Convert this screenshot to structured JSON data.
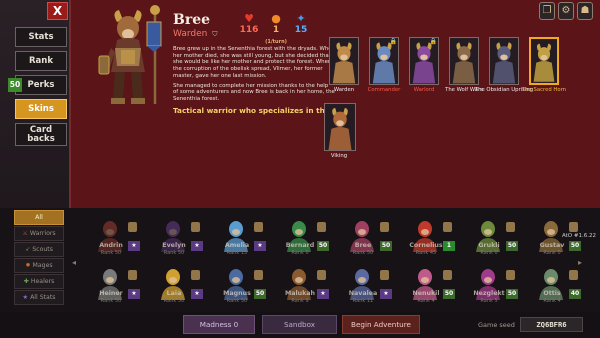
{
  "window": {
    "close_label": "X"
  },
  "menu": {
    "items": [
      {
        "label": "Stats"
      },
      {
        "label": "Rank"
      },
      {
        "label": "Perks",
        "badge": "50"
      },
      {
        "label": "Skins",
        "active": true
      },
      {
        "label": "Card\nbacks"
      }
    ]
  },
  "hero": {
    "name": "Bree",
    "class": "Warden",
    "stats": {
      "health": "116",
      "speed": "1",
      "speed_unit": "(1/turn)",
      "energy": "15"
    },
    "description": [
      "Bree grew up in the Senenthia forest with the dryads. When her mother died, she was still young, but she decided that she would be like her mother and protect the forest. When the corruption of the obelisk spread, Vlimer, her former master, gave her one last mission.",
      "She managed to complete her mission thanks to the help of some adventurers and now Bree is back in her home, the Senenthia forest."
    ],
    "tagline": "Tactical warrior who specializes in thorns."
  },
  "skins": [
    {
      "label": "Warden",
      "color": "#eeeeee",
      "locked": false
    },
    {
      "label": "Commander",
      "color": "#ff5a48",
      "locked": true
    },
    {
      "label": "Warlord",
      "color": "#ff5a48",
      "locked": true
    },
    {
      "label": "The Wolf Wars",
      "color": "#eeeeee",
      "locked": false
    },
    {
      "label": "The Obsidian Uprising",
      "color": "#eeeeee",
      "locked": false
    },
    {
      "label": "The Sacred Horn",
      "color": "#f5b83a",
      "locked": false,
      "selected": true
    },
    {
      "label": "Viking",
      "color": "#eeeeee",
      "locked": false
    }
  ],
  "filters": [
    {
      "label": "All",
      "active": true
    },
    {
      "label": "Warriors",
      "icon": "sword-icon"
    },
    {
      "label": "Scouts",
      "icon": "bow-icon"
    },
    {
      "label": "Mages",
      "icon": "fire-icon"
    },
    {
      "label": "Healers",
      "icon": "cross-icon"
    },
    {
      "label": "All Stats",
      "icon": "star-icon"
    }
  ],
  "roster": {
    "row1": [
      {
        "name": "Andrin",
        "rank": "Rank 50",
        "badge": "",
        "color": "#c24b3a"
      },
      {
        "name": "Evelyn",
        "rank": "Rank 50",
        "badge": "",
        "color": "#7e4aa8"
      },
      {
        "name": "Amelia",
        "rank": "Rank 15",
        "badge": "",
        "color": "#5a9bd0"
      },
      {
        "name": "Bernard",
        "rank": "Rank 0",
        "badge": "50",
        "color": "#3a8a4a"
      },
      {
        "name": "Bree",
        "rank": "Rank 50",
        "badge": "50",
        "color": "#a04060"
      },
      {
        "name": "Cornelius",
        "rank": "Rank 45",
        "badge": "1",
        "color": "#c0392b"
      },
      {
        "name": "Grukli",
        "rank": "Rank 0",
        "badge": "50",
        "color": "#6b8a3a"
      },
      {
        "name": "Gustav",
        "rank": "Rank 0",
        "badge": "50",
        "color": "#8a6a3a"
      }
    ],
    "row2": [
      {
        "name": "Heiner",
        "rank": "Rank 50",
        "badge": "",
        "color": "#7a7a7a"
      },
      {
        "name": "Laia",
        "rank": "Rank 50",
        "badge": "",
        "color": "#d0a030"
      },
      {
        "name": "Magnus",
        "rank": "Rank 50",
        "badge": "50",
        "color": "#4a6aa0"
      },
      {
        "name": "Malukah",
        "rank": "Rank 9",
        "badge": "",
        "color": "#8a5a30"
      },
      {
        "name": "Navalea",
        "rank": "Rank 11",
        "badge": "",
        "color": "#5a6aa0"
      },
      {
        "name": "Nenukil",
        "rank": "Rank 4",
        "badge": "50",
        "color": "#c05a8a"
      },
      {
        "name": "Nezglekt",
        "rank": "Rank 5",
        "badge": "50",
        "color": "#a03a8a"
      },
      {
        "name": "Ottis",
        "rank": "Rank 4",
        "badge": "40",
        "color": "#6a8a6a"
      }
    ]
  },
  "bottom": {
    "madness": "Madness 0",
    "sandbox": "Sandbox",
    "adventure": "Begin Adventure",
    "seed_label": "Game seed",
    "seed": "ZQ6BFR6",
    "version": "AtO #1.6.22"
  }
}
